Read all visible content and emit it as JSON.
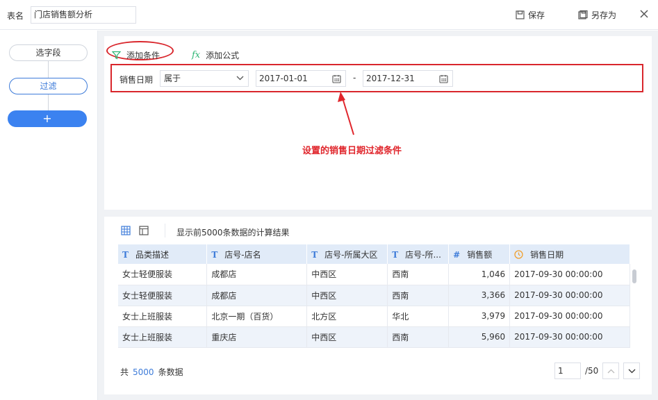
{
  "header": {
    "table_label": "表名",
    "table_name": "门店销售额分析",
    "save_label": "保存",
    "save_as_label": "另存为"
  },
  "sidebar": {
    "steps": [
      {
        "label": "选字段"
      },
      {
        "label": "过滤"
      },
      {
        "label": "+"
      }
    ]
  },
  "filter": {
    "add_condition_label": "添加条件",
    "add_formula_label": "添加公式",
    "field": "销售日期",
    "operator": "属于",
    "start_date": "2017-01-01",
    "separator": "-",
    "end_date": "2017-12-31",
    "annotation": "设置的销售日期过滤条件"
  },
  "result": {
    "title": "显示前5000条数据的计算结果",
    "columns": [
      {
        "label": "品类描述",
        "icon": "T"
      },
      {
        "label": "店号-店名",
        "icon": "T"
      },
      {
        "label": "店号-所属大区",
        "icon": "T"
      },
      {
        "label": "店号-所...",
        "icon": "T"
      },
      {
        "label": "销售额",
        "icon": "#"
      },
      {
        "label": "销售日期",
        "icon": "clock"
      }
    ],
    "rows": [
      [
        "女士轻便服装",
        "成都店",
        "中西区",
        "西南",
        "1,046",
        "2017-09-30 00:00:00"
      ],
      [
        "女士轻便服装",
        "成都店",
        "中西区",
        "西南",
        "3,366",
        "2017-09-30 00:00:00"
      ],
      [
        "女士上班服装",
        "北京一期（百货）",
        "北方区",
        "华北",
        "3,979",
        "2017-09-30 00:00:00"
      ],
      [
        "女士上班服装",
        "重庆店",
        "中西区",
        "西南",
        "5,960",
        "2017-09-30 00:00:00"
      ]
    ],
    "total_prefix": "共",
    "total_count": "5000",
    "total_suffix": "条数据",
    "page_current": "1",
    "page_total": "/50"
  },
  "colors": {
    "accent": "#3d7bd9",
    "highlight": "#d9262c"
  }
}
